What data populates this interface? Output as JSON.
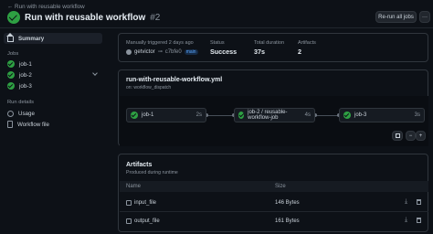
{
  "header": {
    "back_link": "← Run with reusable workflow",
    "title": "Run with reusable workflow",
    "run_number": "#2",
    "rerun_button": "Re-run all jobs",
    "more_label": "···"
  },
  "sidebar": {
    "summary": "Summary",
    "jobs_heading": "Jobs",
    "jobs": [
      {
        "label": "job-1"
      },
      {
        "label": "job-2"
      },
      {
        "label": "job-3"
      }
    ],
    "run_details_heading": "Run details",
    "details": [
      {
        "label": "Usage"
      },
      {
        "label": "Workflow file"
      }
    ]
  },
  "summary": {
    "trigger_label": "Manually triggered 2 days ago",
    "actor": "getvictor",
    "commit": "c7bfe0",
    "branch": "main",
    "status_label": "Status",
    "status_value": "Success",
    "duration_label": "Total duration",
    "duration_value": "37s",
    "artifacts_label": "Artifacts",
    "artifacts_value": "2"
  },
  "workflow": {
    "file": "run-with-reusable-workflow.yml",
    "trigger": "on: workflow_dispatch",
    "nodes": [
      {
        "label": "job-1",
        "duration": "2s"
      },
      {
        "label": "job-2 / reusable-workflow-job",
        "duration": "4s"
      },
      {
        "label": "job-3",
        "duration": "3s"
      }
    ],
    "zoom_out": "−",
    "zoom_in": "+"
  },
  "artifacts": {
    "title": "Artifacts",
    "subtitle": "Produced during runtime",
    "col_name": "Name",
    "col_size": "Size",
    "rows": [
      {
        "name": "input_file",
        "size": "146 Bytes"
      },
      {
        "name": "output_file",
        "size": "161 Bytes"
      }
    ]
  },
  "colors": {
    "background": "#0d1117",
    "success": "#2ea043",
    "border": "#30363d",
    "muted": "#8b949e"
  }
}
